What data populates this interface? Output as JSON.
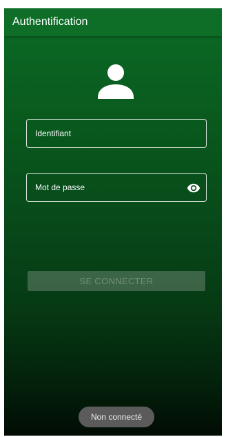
{
  "appbar": {
    "title": "Authentification"
  },
  "icons": {
    "user": "account-icon",
    "visibility": "eye-icon"
  },
  "form": {
    "username": {
      "placeholder": "Identifiant",
      "value": ""
    },
    "password": {
      "placeholder": "Mot de passe",
      "value": ""
    },
    "submit_label": "SE CONNECTER",
    "submit_enabled": false
  },
  "toast": {
    "message": "Non connecté"
  },
  "colors": {
    "appbar": "#0e6e28",
    "background_top": "#0b6b25",
    "background_bottom": "#020c04",
    "toast": "#5b5b5b"
  }
}
